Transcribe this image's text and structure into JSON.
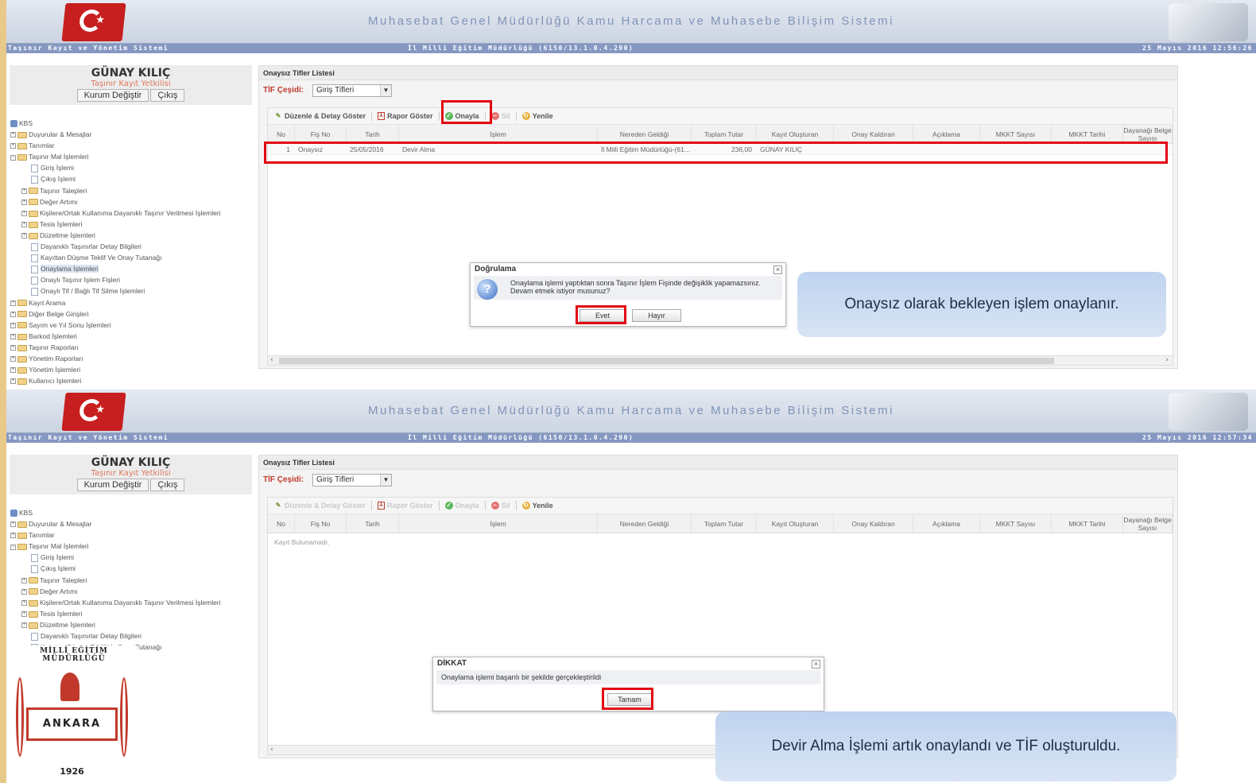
{
  "banner": {
    "title": "Muhasebat Genel Müdürlüğü Kamu Harcama ve Muhasebe Bilişim Sistemi"
  },
  "screens": [
    {
      "infobar": {
        "left": "Taşınır Kayıt ve Yönetim Sistemi",
        "center": "İl Milli Eğitim Müdürlüğü (6150/13.1.0.4.290)",
        "right": "25 Mayıs 2016 12:56:26"
      },
      "user": {
        "name": "GÜNAY KILIÇ",
        "role": "Taşınır Kayıt Yetkilisi",
        "change_btn": "Kurum Değiştir",
        "logout_btn": "Çıkış"
      },
      "main_title": "Onaysız Tifler Listesi",
      "tif": {
        "label": "TİF Çeşidi:",
        "value": "Giriş Tifleri"
      },
      "toolbar": {
        "edit": "Düzenle & Detay Göster",
        "report": "Rapor Göster",
        "approve": "Onayla",
        "delete": "Sil",
        "refresh": "Yenile"
      },
      "row": {
        "no": "1",
        "fis_no": "Onaysız",
        "tarih": "25/05/2016",
        "islem": "Devir Alma",
        "nereden": "İl Milli Eğitim Müdürlüğü-(61...",
        "tutar": "236,00",
        "olusturan": "GÜNAY KILIÇ"
      },
      "dialog": {
        "title": "Doğrulama",
        "message": "Onaylama işlemi yaptıktan sonra Taşınır İşlem Fişinde değişiklik yapamazsınız. Devam etmek istiyor musunuz?",
        "yes": "Evet",
        "no": "Hayır"
      },
      "callout": "Onaysız olarak bekleyen işlem onaylanır."
    },
    {
      "infobar": {
        "left": "Taşınır Kayıt ve Yönetim Sistemi",
        "center": "İl Milli Eğitim Müdürlüğü (6150/13.1.0.4.290)",
        "right": "25 Mayıs 2016 12:57:34"
      },
      "user": {
        "name": "GÜNAY KILIÇ",
        "role": "Taşınır Kayıt Yetkilisi",
        "change_btn": "Kurum Değiştir",
        "logout_btn": "Çıkış"
      },
      "main_title": "Onaysız Tifler Listesi",
      "tif": {
        "label": "TİF Çeşidi:",
        "value": "Giriş Tifleri"
      },
      "toolbar": {
        "edit": "Düzenle & Detay Göster",
        "report": "Rapor Göster",
        "approve": "Onayla",
        "delete": "Sil",
        "refresh": "Yenile"
      },
      "empty": "Kayıt Bulunamadı.",
      "dialog": {
        "title": "DİKKAT",
        "message": "Onaylama işlemi başarılı bir şekilde gerçekleştirildi",
        "ok": "Tamam"
      },
      "callout": "Devir Alma İşlemi artık onaylandı ve TİF oluşturuldu."
    }
  ],
  "columns": [
    "No",
    "Fiş No",
    "Tarih",
    "İşlem",
    "Nereden Geldiği",
    "Toplam Tutar",
    "Kayıt Oluşturan",
    "Onay Kaldıran",
    "Açıklama",
    "MKKT Sayısı",
    "MKKT Tarihi",
    "Dayanağı Belge Sayısı"
  ],
  "tree": {
    "root": "KBS",
    "items": [
      "Duyurular & Mesajlar",
      "Tanımlar",
      "Taşınır Mal İşlemleri",
      "Giriş İşlemi",
      "Çıkış İşlemi",
      "Taşınır Talepleri",
      "Değer Artımı",
      "Kişilere/Ortak Kullanıma Dayanıklı Taşınır Verilmesi İşlemleri",
      "Tesis İşlemleri",
      "Düzeltme İşlemleri",
      "Dayanıklı Taşınırlar Detay Bilgileri",
      "Kayıttan Düşme Teklif Ve Onay Tutanağı",
      "Onaylama İşlemleri",
      "Onaylı Taşınır İşlem Fişleri",
      "Onaylı Tif / Bağlı Tif Silme İşlemleri",
      "Kayıt Arama",
      "Diğer Belge Girişleri",
      "Sayım ve Yıl Sonu İşlemleri",
      "Barkod İşlemleri",
      "Taşınır Raporları",
      "Yönetim Raporları",
      "Yönetim İşlemleri",
      "Kullanıcı İşlemleri"
    ]
  },
  "logo": {
    "ring": "MİLLİ EĞİTİM MÜDÜRLÜĞÜ",
    "city": "ANKARA",
    "year": "1926"
  },
  "colors": {
    "highlight": "#e30613",
    "infobar": "#8598c2",
    "callout": "#c9daf1"
  }
}
